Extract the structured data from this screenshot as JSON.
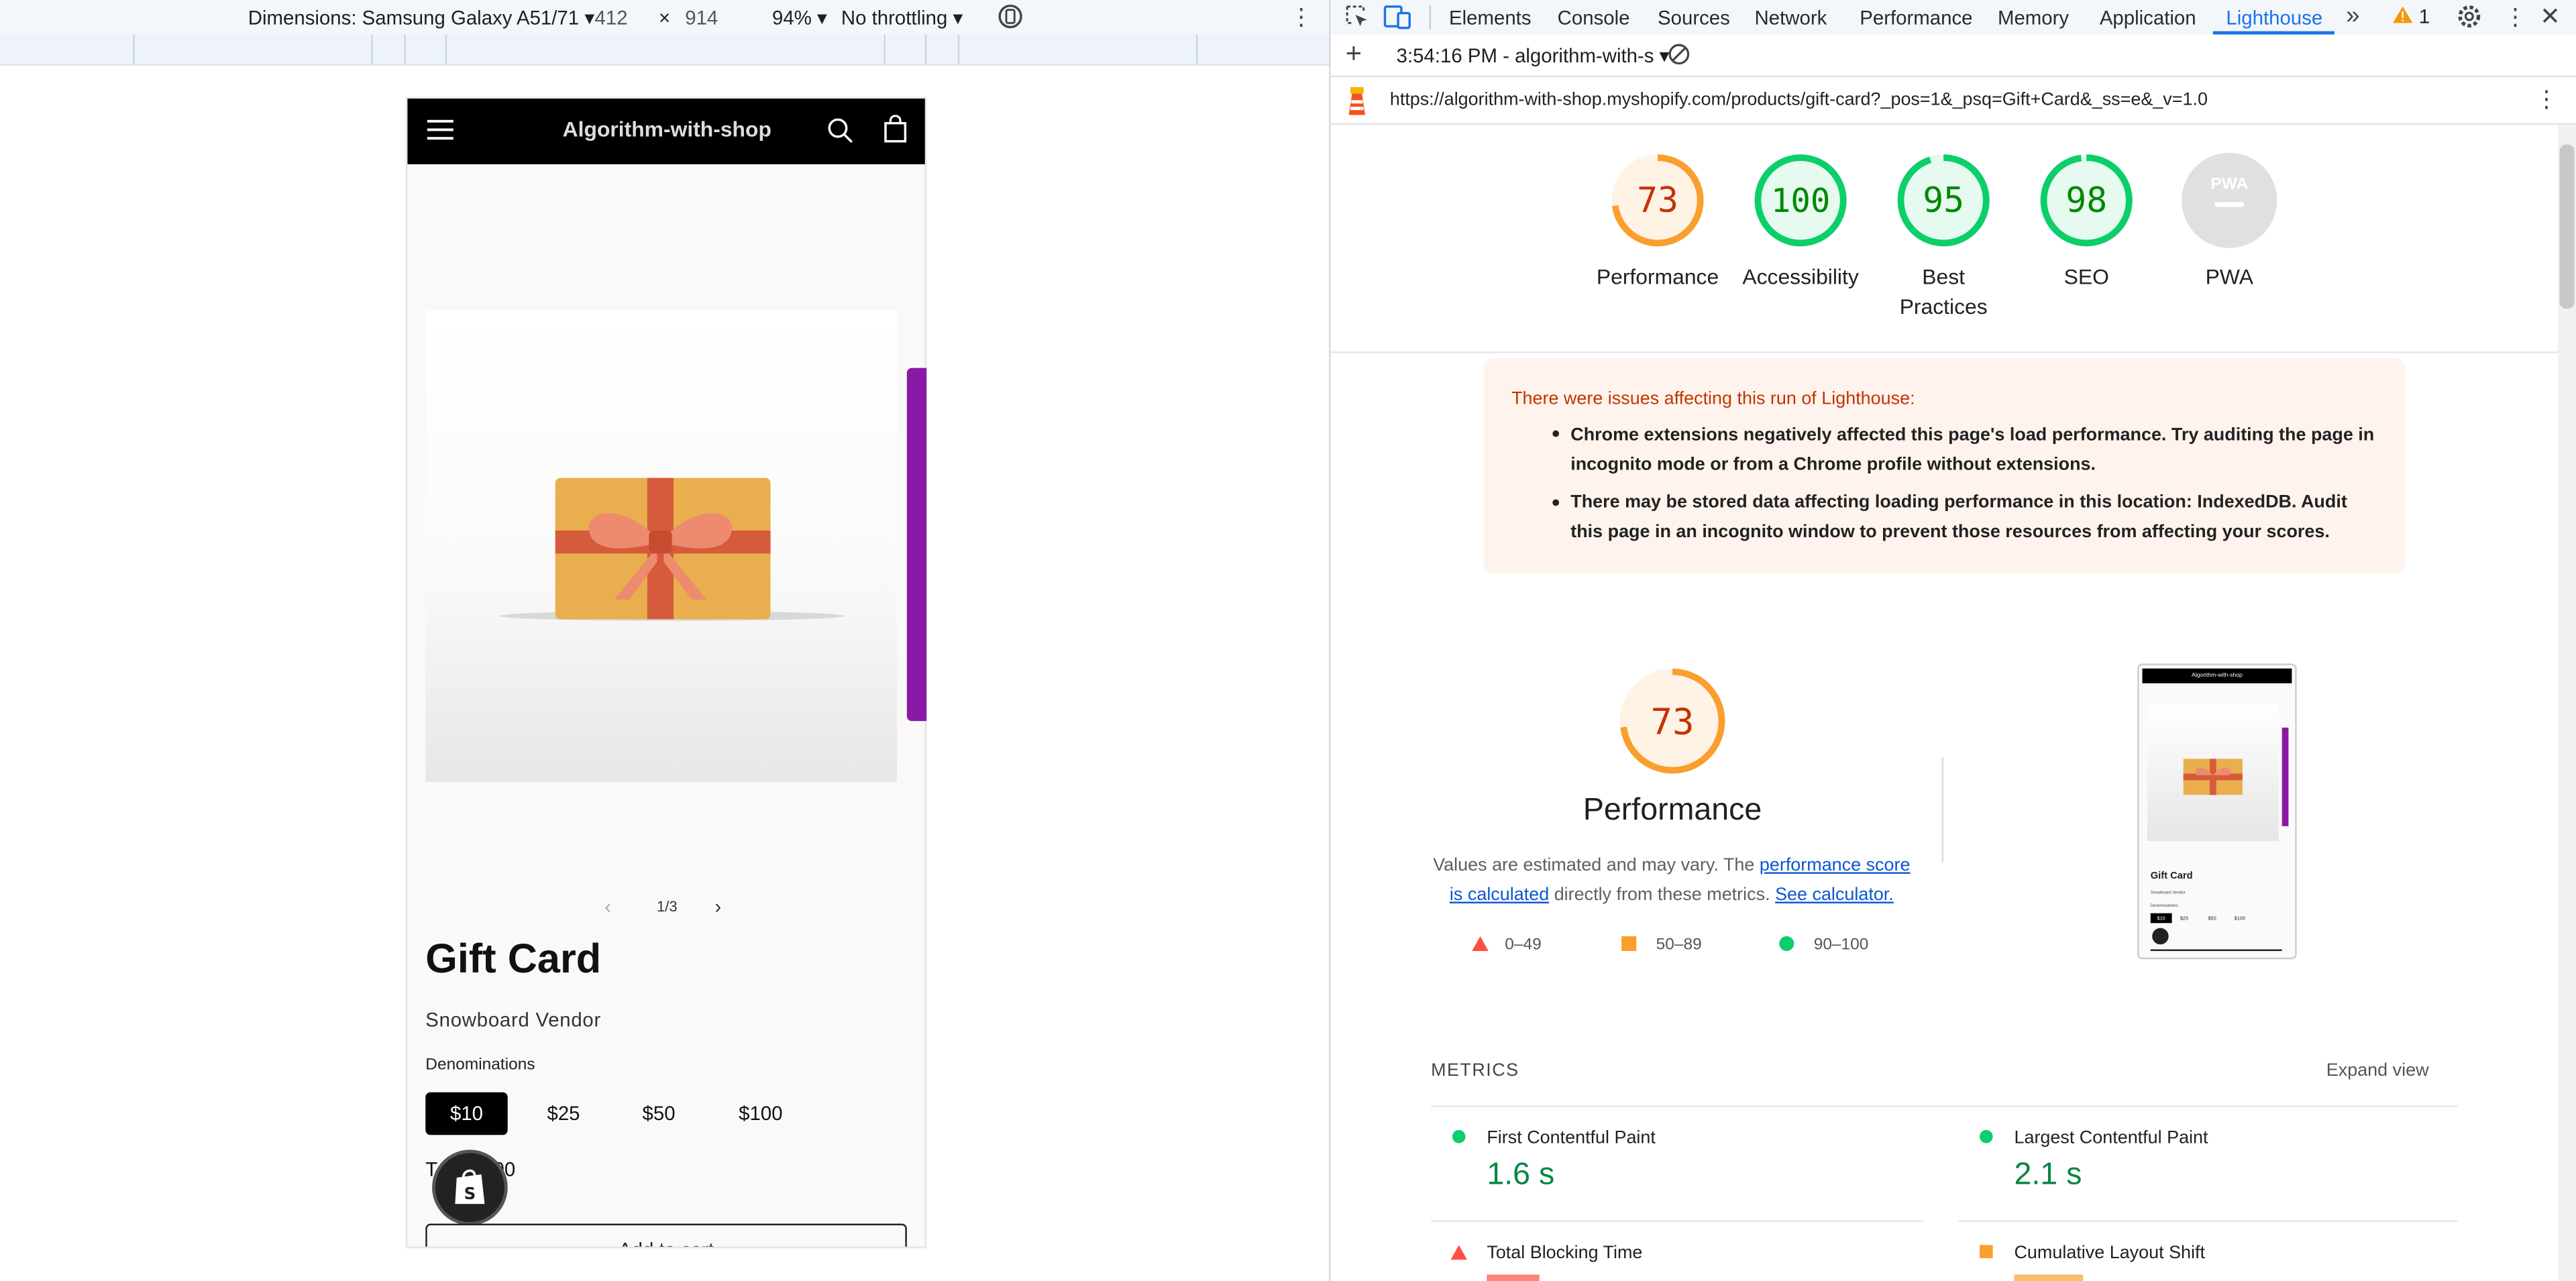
{
  "device_toolbar": {
    "device": "Dimensions: Samsung Galaxy A51/71",
    "width": "412",
    "times": "×",
    "height": "914",
    "zoom": "94%",
    "throttle": "No throttling"
  },
  "shop": {
    "site_title": "Algorithm-with-shop",
    "pager": "1/3",
    "product_title": "Gift Card",
    "vendor": "Snowboard Vendor",
    "denom_label": "Denominations",
    "denominations": [
      "$10",
      "$25",
      "$50",
      "$100"
    ],
    "total_partial": "T",
    "total_partial_end": "00",
    "add_to_cart": "Add to cart"
  },
  "devtools": {
    "tabs": [
      "Elements",
      "Console",
      "Sources",
      "Network",
      "Performance",
      "Memory",
      "Application",
      "Lighthouse"
    ],
    "active_tab": "Lighthouse",
    "warning_count": "1",
    "session": "3:54:16 PM - algorithm-with-s",
    "url": "https://algorithm-with-shop.myshopify.com/products/gift-card?_pos=1&_psq=Gift+Card&_ss=e&_v=1.0"
  },
  "scores": [
    {
      "label": "Performance",
      "value": "73",
      "score": 73,
      "color": "#fa9f2d",
      "text_color": "#c33300"
    },
    {
      "label": "Accessibility",
      "value": "100",
      "score": 100,
      "color": "#0cce6b",
      "text_color": "#008800"
    },
    {
      "label": "Best Practices",
      "value": "95",
      "score": 95,
      "color": "#0cce6b",
      "text_color": "#008800"
    },
    {
      "label": "SEO",
      "value": "98",
      "score": 98,
      "color": "#0cce6b",
      "text_color": "#008800"
    },
    {
      "label": "PWA",
      "value": "PWA",
      "score": 0,
      "color": "#e0e0e0",
      "text_color": "#9e9e9e"
    }
  ],
  "warning": {
    "title": "There were issues affecting this run of Lighthouse:",
    "items": [
      "Chrome extensions negatively affected this page's load performance. Try auditing the page in incognito mode or from a Chrome profile without extensions.",
      "There may be stored data affecting loading performance in this location: IndexedDB. Audit this page in an incognito window to prevent those resources from affecting your scores."
    ]
  },
  "performance": {
    "score": "73",
    "score_value": 73,
    "title": "Performance",
    "desc_prefix": "Values are estimated and may vary. The ",
    "link1": "performance score is calculated",
    "desc_mid": " directly from these metrics. ",
    "link2": "See calculator.",
    "legend": [
      "0–49",
      "50–89",
      "90–100"
    ]
  },
  "thumb": {
    "site_title": "Algorithm-with-shop",
    "product_title": "Gift Card",
    "vendor": "Snowboard Vendor",
    "denom_label": "Denominations",
    "denominations": [
      "$10",
      "$25",
      "$50",
      "$100"
    ]
  },
  "metrics": {
    "heading": "METRICS",
    "expand": "Expand view",
    "items": [
      {
        "title": "First Contentful Paint",
        "value": "1.6 s",
        "status": "pass"
      },
      {
        "title": "Largest Contentful Paint",
        "value": "2.1 s",
        "status": "pass"
      },
      {
        "title": "Total Blocking Time",
        "value": "",
        "status": "fail"
      },
      {
        "title": "Cumulative Layout Shift",
        "value": "",
        "status": "average"
      }
    ]
  },
  "colors": {
    "pass": "#0cce6b",
    "average": "#fa9f2d",
    "fail": "#ff4e42",
    "accent": "#1a73e8"
  }
}
